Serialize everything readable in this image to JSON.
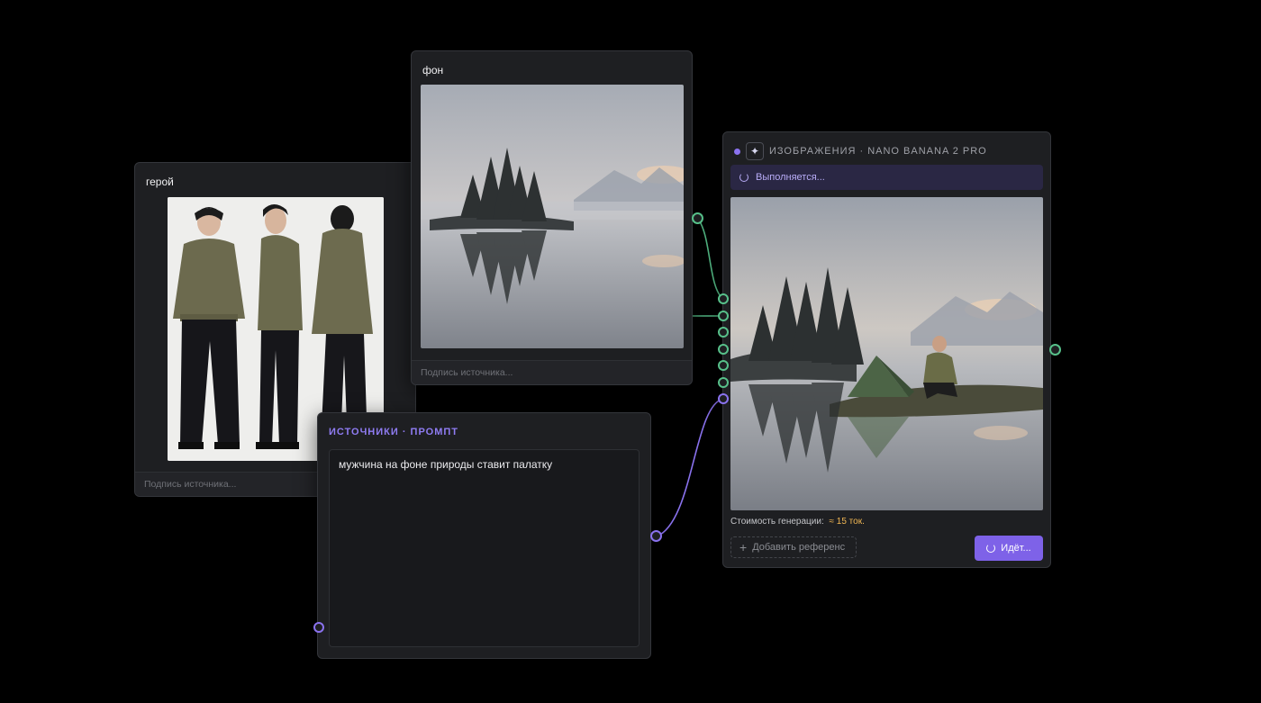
{
  "hero_node": {
    "title": "герой",
    "caption_placeholder": "Подпись источника..."
  },
  "background_node": {
    "title": "фон",
    "caption_placeholder": "Подпись источника..."
  },
  "prompt_node": {
    "header": "ИСТОЧНИКИ · ПРОМПТ",
    "text": "мужчина на фоне природы ставит палатку"
  },
  "generator_node": {
    "title": "ИЗОБРАЖЕНИЯ · NANO BANANA 2 PRO",
    "status": "Выполняется...",
    "cost_label": "Стоимость генерации:",
    "cost_value": "≈ 15 ток.",
    "add_reference_label": "Добавить референс",
    "run_button_label": "Идёт..."
  },
  "colors": {
    "accent_purple": "#7e62e8",
    "port_green": "#57c08a",
    "port_purple": "#8a72ee",
    "cost_amber": "#f0b653"
  },
  "icons": {
    "badge": "sparkle-icon",
    "status": "spinner-icon",
    "add": "plus-icon",
    "button": "spinner-icon"
  }
}
